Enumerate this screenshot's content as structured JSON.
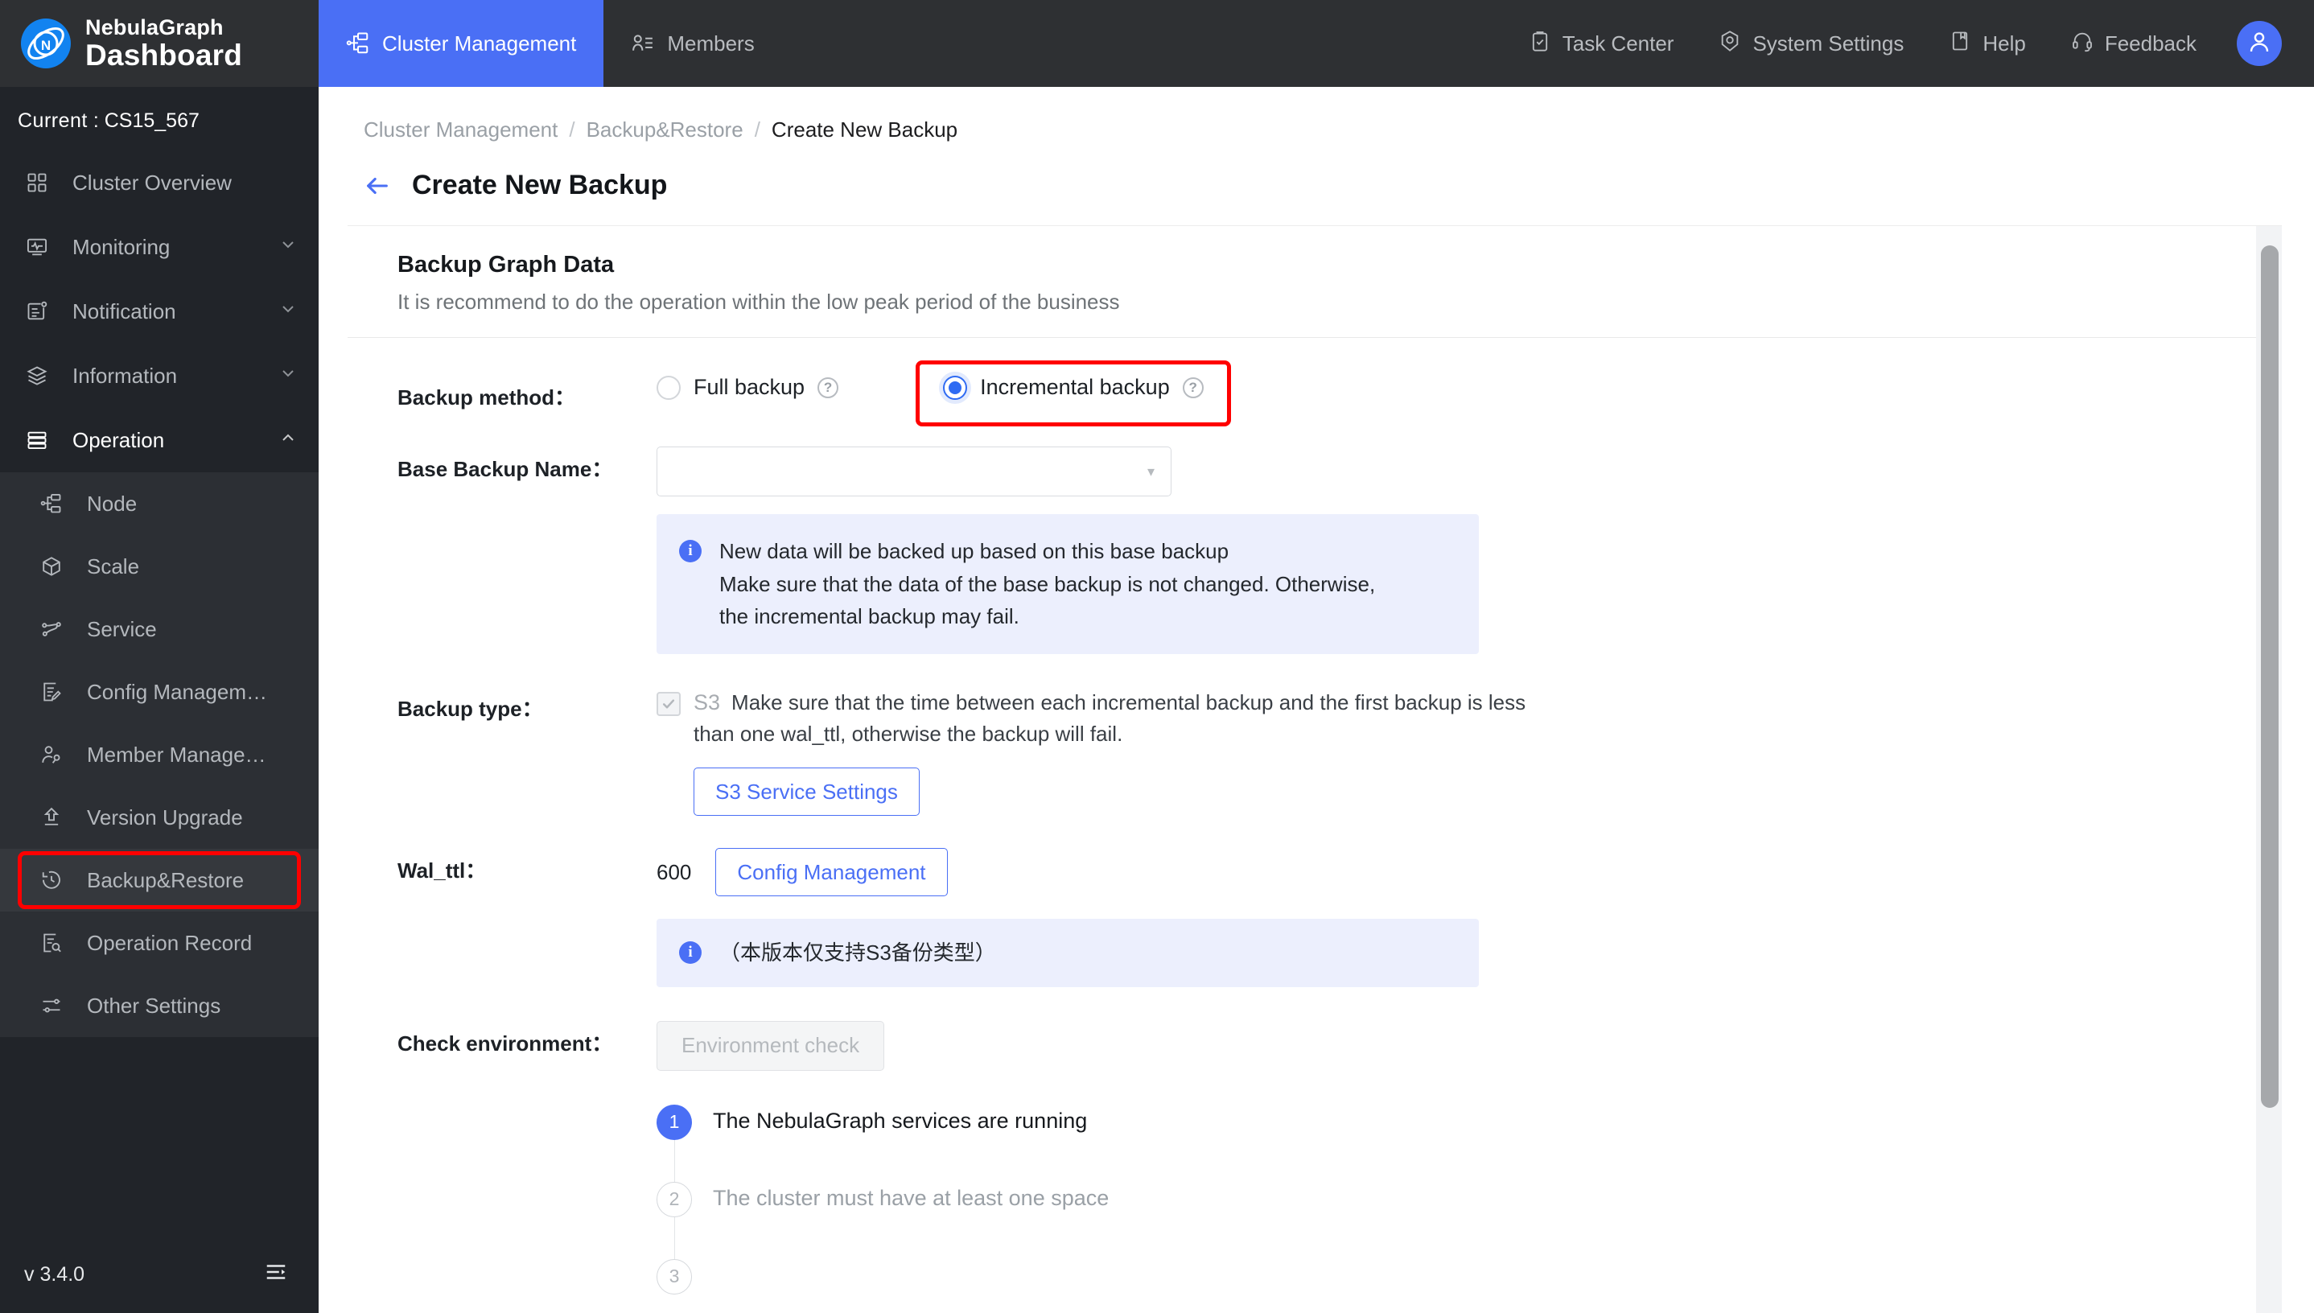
{
  "brand": {
    "line1": "NebulaGraph",
    "line2": "Dashboard",
    "logo_icon": "nebula-logo-icon"
  },
  "topnav": [
    {
      "label": "Cluster Management",
      "icon": "cluster-icon",
      "active": true
    },
    {
      "label": "Members",
      "icon": "members-icon",
      "active": false
    }
  ],
  "topright": [
    {
      "label": "Task Center",
      "icon": "clipboard-check-icon"
    },
    {
      "label": "System Settings",
      "icon": "gear-icon"
    },
    {
      "label": "Help",
      "icon": "book-icon"
    },
    {
      "label": "Feedback",
      "icon": "headset-icon"
    }
  ],
  "avatar_icon": "user-avatar-icon",
  "sidebar": {
    "current_label": "Current",
    "current_sep": ":",
    "current_value": "CS15_567",
    "items": [
      {
        "label": "Cluster Overview",
        "icon": "grid-icon",
        "expandable": false
      },
      {
        "label": "Monitoring",
        "icon": "monitor-icon",
        "expandable": true,
        "expanded": false
      },
      {
        "label": "Notification",
        "icon": "bell-note-icon",
        "expandable": true,
        "expanded": false
      },
      {
        "label": "Information",
        "icon": "layers-icon",
        "expandable": true,
        "expanded": false
      },
      {
        "label": "Operation",
        "icon": "server-icon",
        "expandable": true,
        "expanded": true
      }
    ],
    "sub_items": [
      {
        "label": "Node",
        "icon": "node-tree-icon",
        "highlighted": false
      },
      {
        "label": "Scale",
        "icon": "cube-icon",
        "highlighted": false
      },
      {
        "label": "Service",
        "icon": "service-icon",
        "highlighted": false
      },
      {
        "label": "Config Managem…",
        "icon": "config-edit-icon",
        "highlighted": false
      },
      {
        "label": "Member Manage…",
        "icon": "member-wrench-icon",
        "highlighted": false
      },
      {
        "label": "Version Upgrade",
        "icon": "upgrade-arrow-icon",
        "highlighted": false
      },
      {
        "label": "Backup&Restore",
        "icon": "history-clock-icon",
        "highlighted": true
      },
      {
        "label": "Operation Record",
        "icon": "record-search-icon",
        "highlighted": false
      },
      {
        "label": "Other Settings",
        "icon": "sliders-icon",
        "highlighted": false
      }
    ],
    "version": "v 3.4.0",
    "collapse_icon": "collapse-menu-icon"
  },
  "breadcrumb": {
    "items": [
      "Cluster Management",
      "Backup&Restore",
      "Create New Backup"
    ],
    "separator": "/"
  },
  "page": {
    "back_icon": "back-arrow-icon",
    "title": "Create New Backup"
  },
  "card": {
    "heading": "Backup Graph Data",
    "subheading": "It is recommend to do the operation within the low peak period of the business"
  },
  "form": {
    "backup_method": {
      "label": "Backup method：",
      "options": [
        {
          "label": "Full backup",
          "checked": false,
          "help_icon": "question-circle-icon"
        },
        {
          "label": "Incremental backup",
          "checked": true,
          "help_icon": "question-circle-icon"
        }
      ]
    },
    "base_backup_name": {
      "label": "Base Backup Name：",
      "value": "",
      "placeholder": "",
      "caret_icon": "chevron-down-icon",
      "info_icon": "info-circle-icon",
      "info_lines": [
        "New data will be backed up based on this base backup",
        "Make sure that the data of the base backup is not changed. Otherwise,",
        "the incremental backup may fail."
      ]
    },
    "backup_type": {
      "label": "Backup type：",
      "checkbox_checked": true,
      "checkbox_icon": "check-icon",
      "option_label": "S3",
      "description": "Make sure that the time between each incremental backup and the first backup is less than one wal_ttl, otherwise the backup will fail.",
      "button_label": "S3 Service Settings"
    },
    "wal_ttl": {
      "label": "Wal_ttl：",
      "value": "600",
      "button_label": "Config Management",
      "info_icon": "info-circle-icon",
      "info_text": "（本版本仅支持S3备份类型）"
    },
    "check_environment": {
      "label": "Check environment：",
      "button_label": "Environment check",
      "steps": [
        {
          "number": "1",
          "text": "The NebulaGraph services are running",
          "state": "active"
        },
        {
          "number": "2",
          "text": "The cluster must have at least one space",
          "state": "idle"
        },
        {
          "number": "3",
          "text": "",
          "state": "idle"
        }
      ]
    }
  },
  "colors": {
    "brand_blue": "#4a6ff5",
    "accent_blue": "#2f6bf3",
    "sidebar_bg": "#212429",
    "topbar_bg": "#2e3033",
    "highlight_red": "#ff0000",
    "info_bg": "#eceffd"
  }
}
